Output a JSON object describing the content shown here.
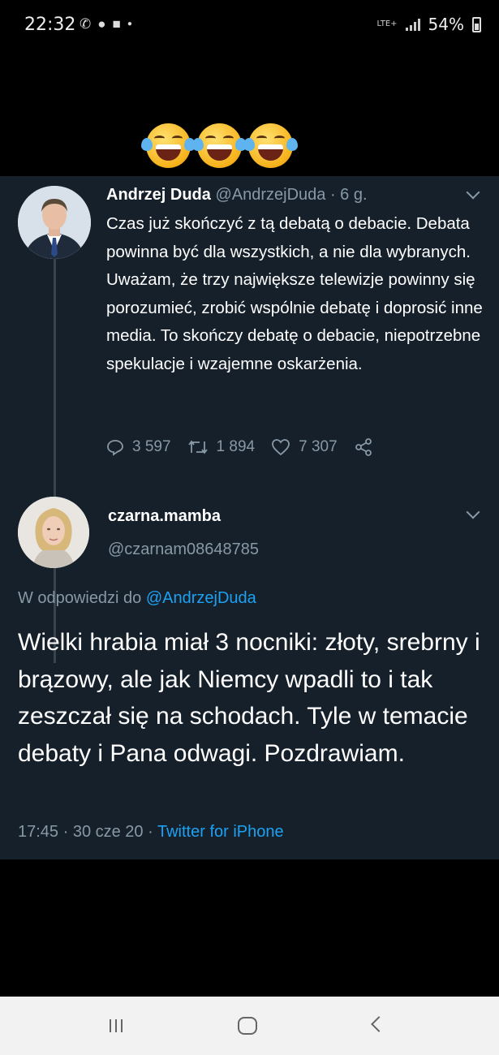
{
  "status_bar": {
    "time": "22:32",
    "network": "LTE+",
    "battery": "54%"
  },
  "reaction_emojis": [
    "face-with-tears-of-joy",
    "face-with-tears-of-joy",
    "face-with-tears-of-joy"
  ],
  "tweet": {
    "author_name": "Andrzej Duda",
    "author_handle": "@AndrzejDuda",
    "time_ago": "· 6 g.",
    "text": "Czas już skończyć z tą debatą o debacie. Debata powinna być dla wszystkich, a nie dla wybranych. Uważam, że trzy największe telewizje powinny się porozumieć, zrobić wspólnie debatę i doprosić inne media. To skończy debatę o debacie, niepotrzebne spekulacje i wzajemne oskarżenia.",
    "replies": "3 597",
    "retweets": "1 894",
    "likes": "7 307"
  },
  "reply": {
    "author_name": "czarna.mamba",
    "author_handle": "@czarnam08648785",
    "replying_prefix": "W odpowiedzi do",
    "replying_to": "@AndrzejDuda",
    "text": "Wielki hrabia miał 3 nocniki: złoty, srebrny i brązowy, ale jak Niemcy wpadli to i tak zeszczał się na schodach. Tyle w temacie debaty i Pana odwagi. Pozdrawiam.",
    "timestamp": "17:45 · 30 cze 20 ·",
    "source": "Twitter for iPhone"
  },
  "colors": {
    "card_background": "#15202b",
    "secondary_text": "#8899a6",
    "link": "#1da1f2"
  }
}
